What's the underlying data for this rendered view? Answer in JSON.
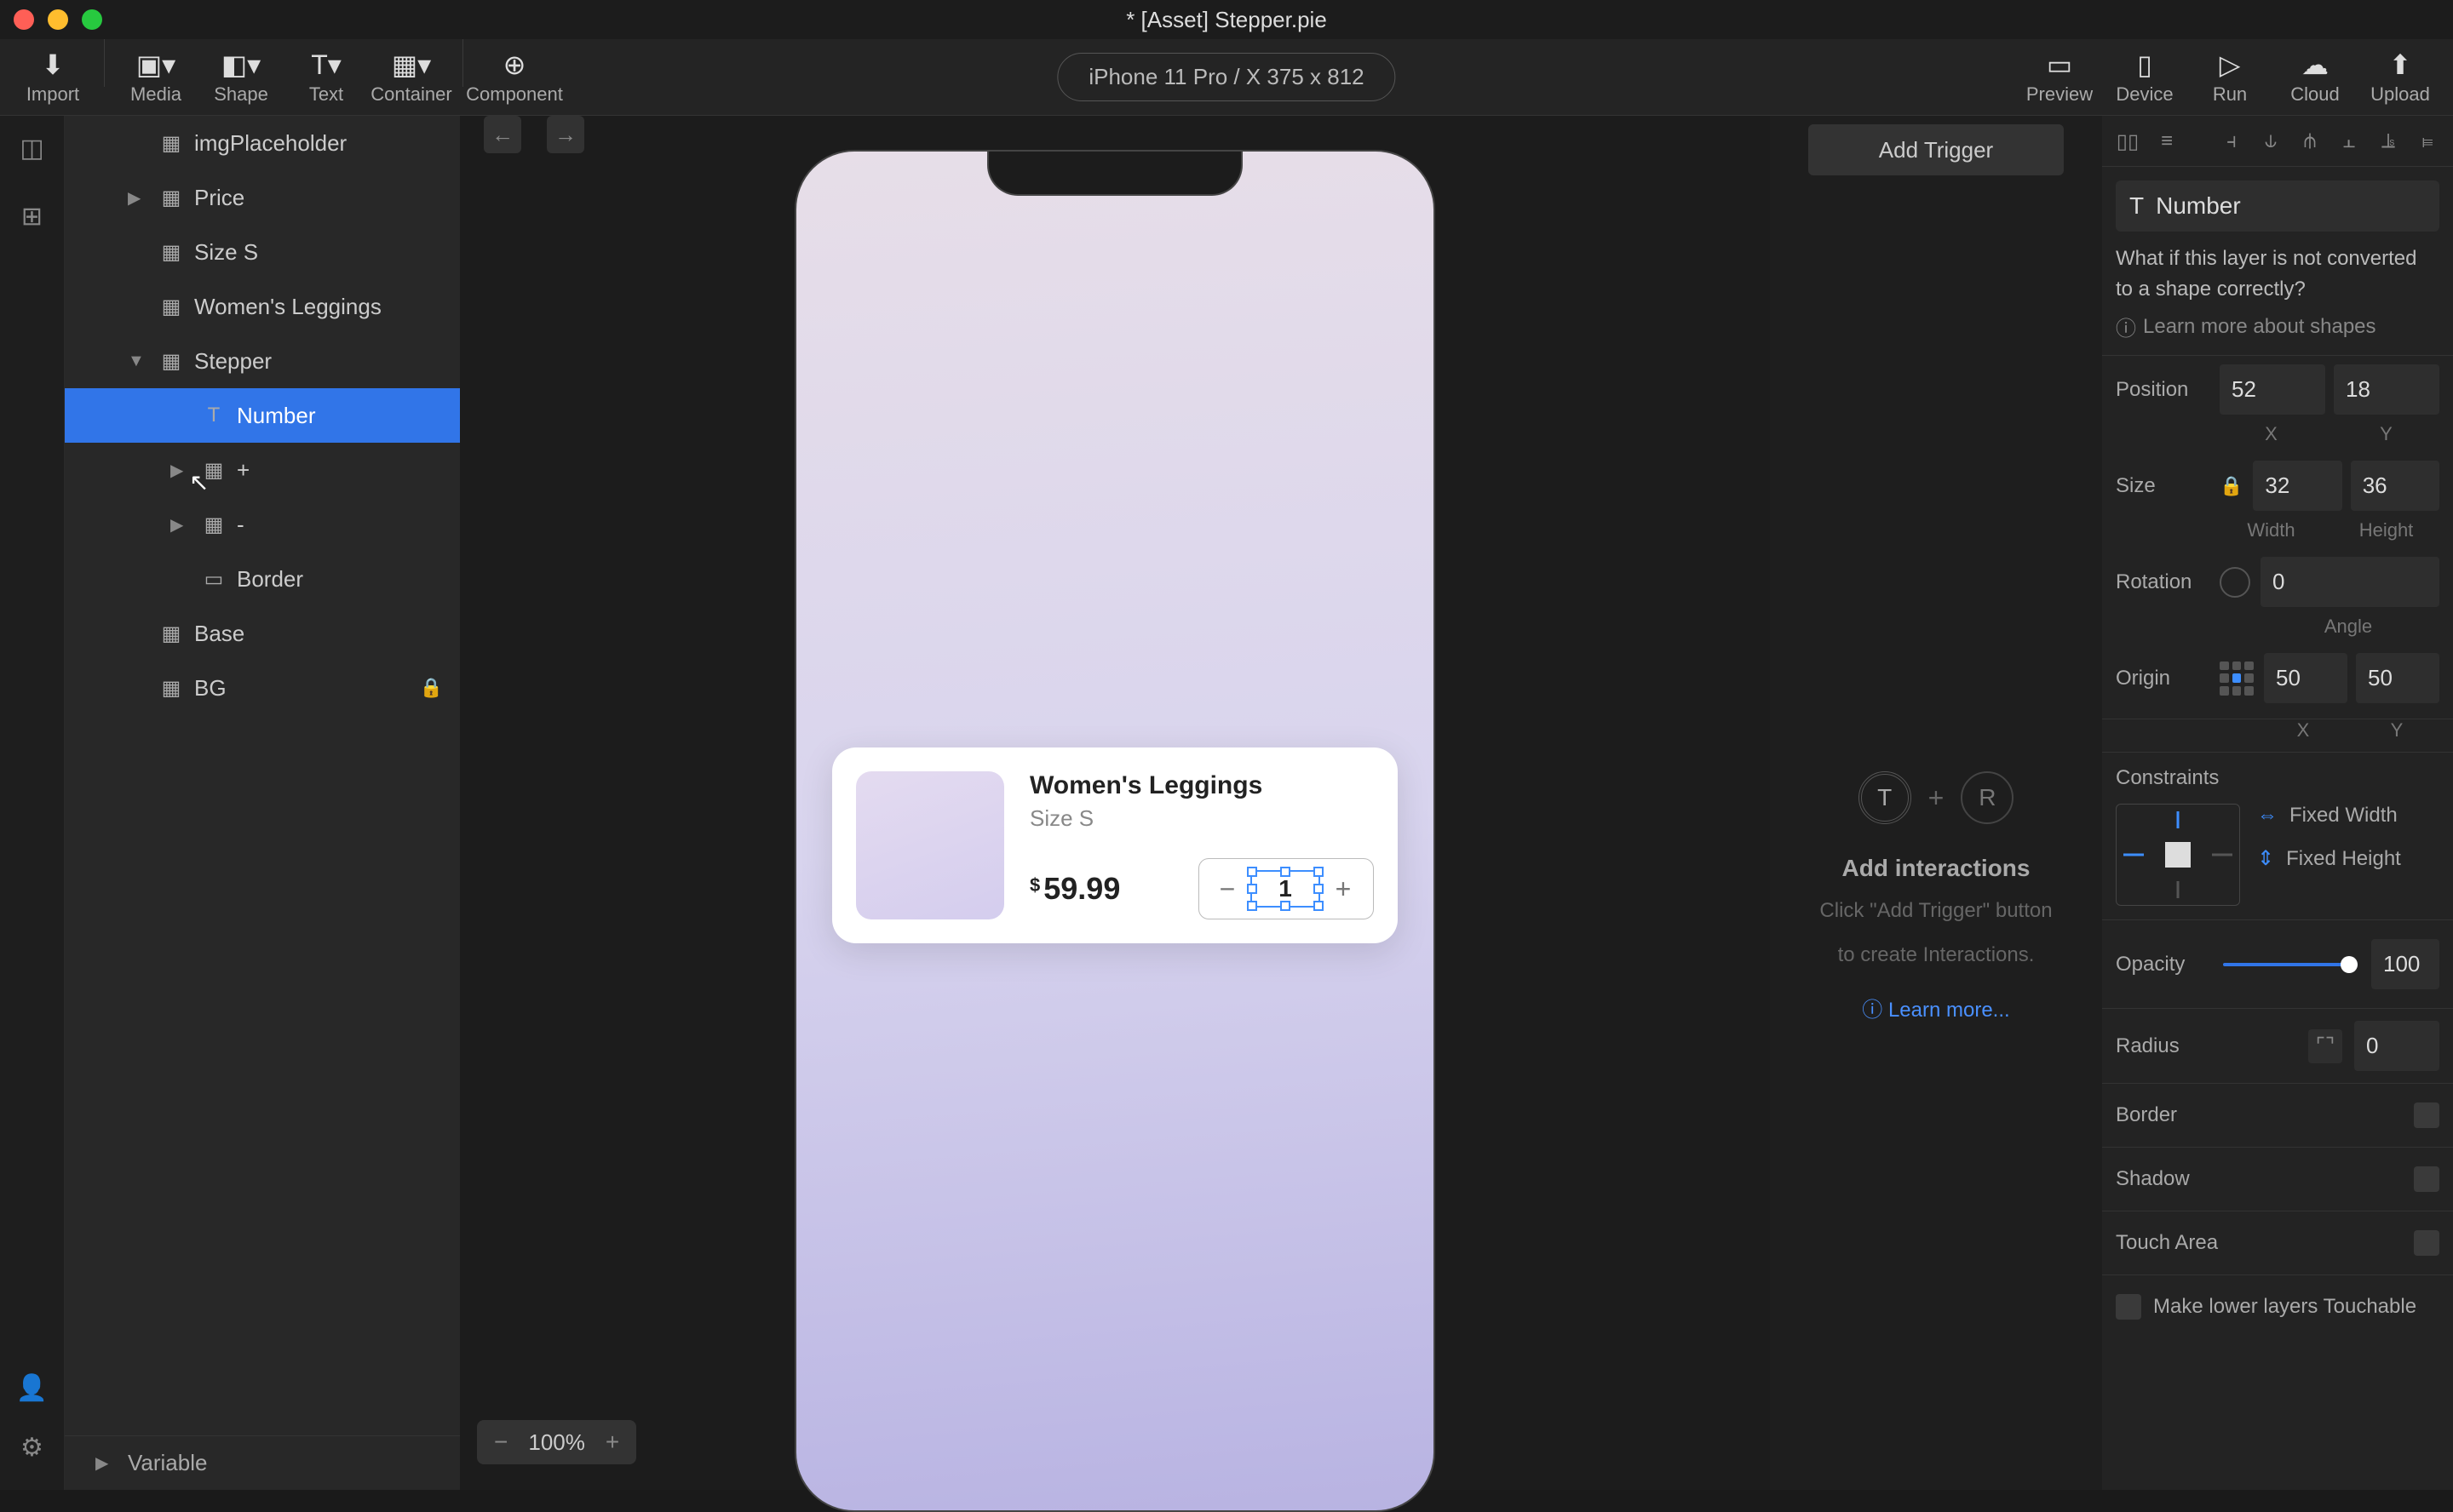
{
  "title": "* [Asset] Stepper.pie",
  "toolbar": {
    "import": "Import",
    "media": "Media",
    "shape": "Shape",
    "text": "Text",
    "container": "Container",
    "component": "Component",
    "preview": "Preview",
    "device": "Device",
    "run": "Run",
    "cloud": "Cloud",
    "upload": "Upload"
  },
  "device_label": "iPhone 11 Pro / X  375 x 812",
  "layers": [
    {
      "label": "imgPlaceholder",
      "indent": 1,
      "icon": "image"
    },
    {
      "label": "Price",
      "indent": 1,
      "icon": "group",
      "chevron": "▶"
    },
    {
      "label": "Size S",
      "indent": 1,
      "icon": "image"
    },
    {
      "label": "Women's Leggings",
      "indent": 1,
      "icon": "image"
    },
    {
      "label": "Stepper",
      "indent": 1,
      "icon": "group",
      "chevron": "▼"
    },
    {
      "label": "Number",
      "indent": 2,
      "icon": "text",
      "selected": true
    },
    {
      "label": "+",
      "indent": 2,
      "icon": "group",
      "chevron": "▶"
    },
    {
      "label": "-",
      "indent": 2,
      "icon": "group",
      "chevron": "▶"
    },
    {
      "label": "Border",
      "indent": 2,
      "icon": "rect"
    },
    {
      "label": "Base",
      "indent": 1,
      "icon": "image"
    },
    {
      "label": "BG",
      "indent": 1,
      "icon": "image",
      "locked": true
    }
  ],
  "variable_label": "Variable",
  "zoom": "100%",
  "card": {
    "title": "Women's Leggings",
    "subtitle": "Size S",
    "currency": "$",
    "price": "59.99",
    "qty": "1"
  },
  "interactions": {
    "add_trigger": "Add Trigger",
    "heading": "Add interactions",
    "sub1": "Click \"Add Trigger\" button",
    "sub2": "to create Interactions.",
    "learn": "Learn more..."
  },
  "inspector": {
    "selected_name": "Number",
    "warn": "What if this layer is not converted to a shape correctly?",
    "learn_shapes": "Learn more about shapes",
    "position": {
      "label": "Position",
      "x": "52",
      "y": "18",
      "xl": "X",
      "yl": "Y"
    },
    "size": {
      "label": "Size",
      "w": "32",
      "h": "36",
      "wl": "Width",
      "hl": "Height"
    },
    "rotation": {
      "label": "Rotation",
      "angle": "0",
      "al": "Angle"
    },
    "origin": {
      "label": "Origin",
      "x": "50",
      "y": "50",
      "xl": "X",
      "yl": "Y"
    },
    "constraints": {
      "label": "Constraints",
      "fw": "Fixed Width",
      "fh": "Fixed Height"
    },
    "opacity": {
      "label": "Opacity",
      "val": "100"
    },
    "radius": {
      "label": "Radius",
      "val": "0"
    },
    "border": "Border",
    "shadow": "Shadow",
    "touch": "Touch Area",
    "touchable": "Make lower layers Touchable"
  }
}
